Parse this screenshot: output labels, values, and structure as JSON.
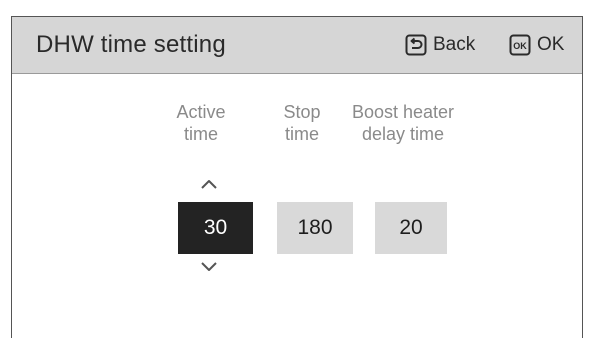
{
  "header": {
    "title": "DHW time setting",
    "back_label": "Back",
    "ok_label": "OK",
    "ok_icon_text": "OK"
  },
  "settings": [
    {
      "label": "Active\ntime",
      "value": "30",
      "selected": true
    },
    {
      "label": "Stop\ntime",
      "value": "180",
      "selected": false
    },
    {
      "label": "Boost heater\ndelay time",
      "value": "20",
      "selected": false
    }
  ],
  "icons": {
    "back": "back-return-icon",
    "ok": "ok-key-icon",
    "increase": "chevron-up-icon",
    "decrease": "chevron-down-icon"
  },
  "colors": {
    "header_bg": "#d6d6d6",
    "selected_bg": "#232323",
    "unselected_bg": "#d9d9d9",
    "label_text": "#8a8a8a"
  }
}
